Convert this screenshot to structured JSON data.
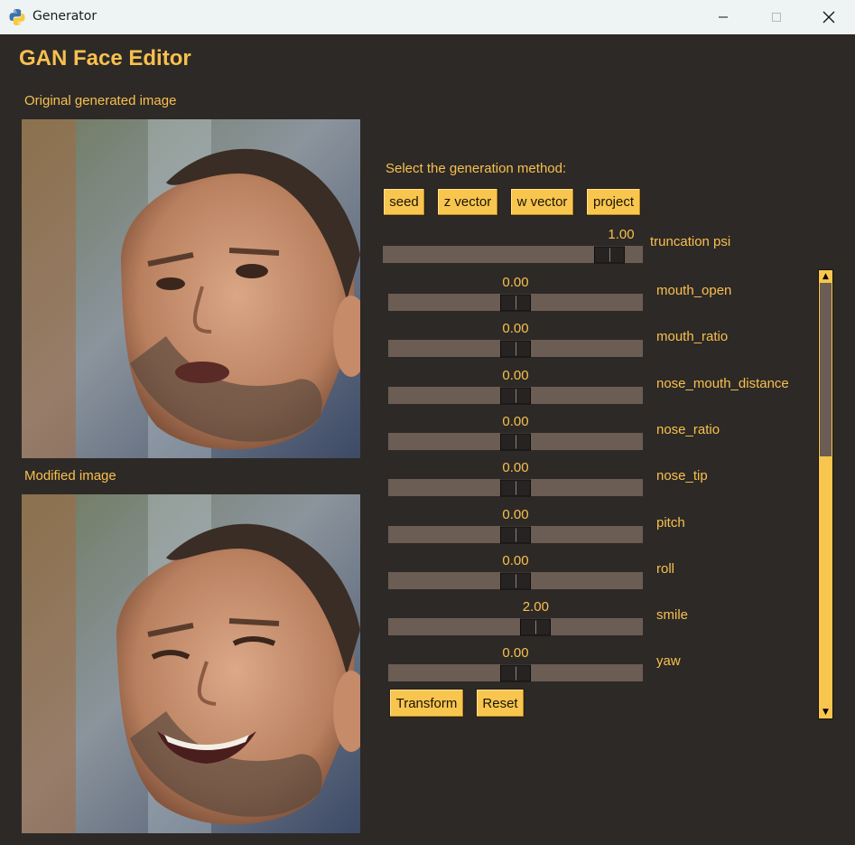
{
  "window": {
    "title": "Generator"
  },
  "app": {
    "title": "GAN Face Editor"
  },
  "images": {
    "original_label": "Original generated image",
    "modified_label": "Modified image"
  },
  "method": {
    "prompt": "Select the generation method:",
    "buttons": [
      "seed",
      "z vector",
      "w vector",
      "project"
    ]
  },
  "truncation": {
    "label": "truncation psi",
    "value_text": "1.00",
    "fraction": 0.92
  },
  "sliders": [
    {
      "label": "mouth_open",
      "value_text": "0.00",
      "fraction": 0.5
    },
    {
      "label": "mouth_ratio",
      "value_text": "0.00",
      "fraction": 0.5
    },
    {
      "label": "nose_mouth_distance",
      "value_text": "0.00",
      "fraction": 0.5
    },
    {
      "label": "nose_ratio",
      "value_text": "0.00",
      "fraction": 0.5
    },
    {
      "label": "nose_tip",
      "value_text": "0.00",
      "fraction": 0.5
    },
    {
      "label": "pitch",
      "value_text": "0.00",
      "fraction": 0.5
    },
    {
      "label": "roll",
      "value_text": "0.00",
      "fraction": 0.5
    },
    {
      "label": "smile",
      "value_text": "2.00",
      "fraction": 0.59
    },
    {
      "label": "yaw",
      "value_text": "0.00",
      "fraction": 0.5
    }
  ],
  "actions": {
    "transform": "Transform",
    "reset": "Reset"
  },
  "colors": {
    "accent": "#f8c64e",
    "background": "#2d2926",
    "trough": "#6b5d54"
  }
}
